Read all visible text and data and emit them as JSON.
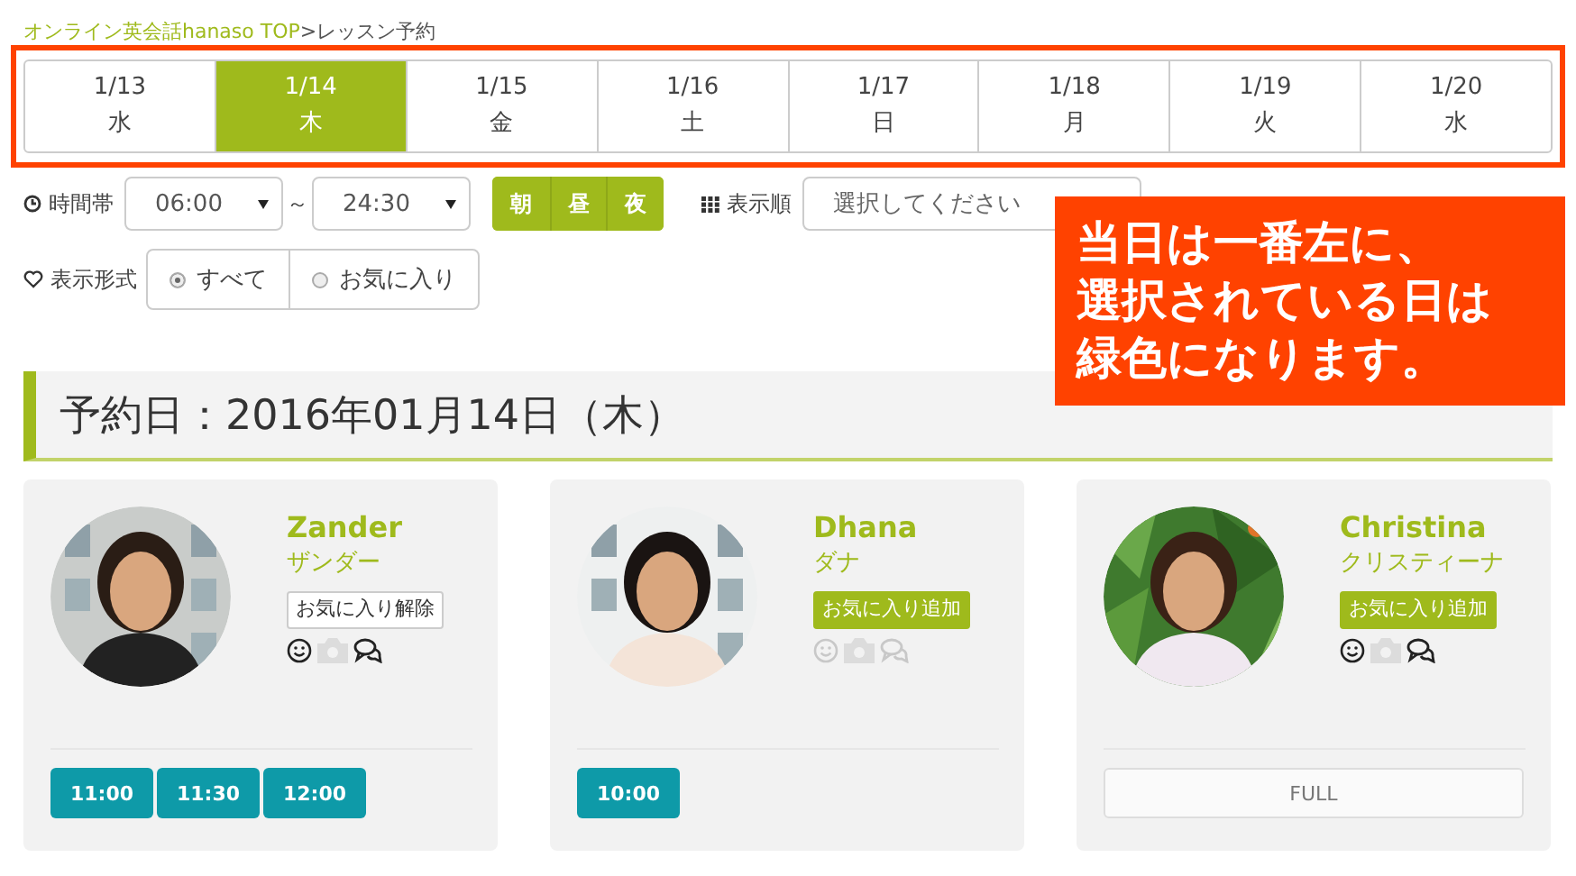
{
  "breadcrumb": {
    "link": "オンライン英会話hanaso TOP",
    "separator": ">",
    "current": "レッスン予約"
  },
  "days": [
    {
      "date": "1/13",
      "weekday": "水",
      "selected": false
    },
    {
      "date": "1/14",
      "weekday": "木",
      "selected": true
    },
    {
      "date": "1/15",
      "weekday": "金",
      "selected": false
    },
    {
      "date": "1/16",
      "weekday": "土",
      "selected": false
    },
    {
      "date": "1/17",
      "weekday": "日",
      "selected": false
    },
    {
      "date": "1/18",
      "weekday": "月",
      "selected": false
    },
    {
      "date": "1/19",
      "weekday": "火",
      "selected": false
    },
    {
      "date": "1/20",
      "weekday": "水",
      "selected": false
    }
  ],
  "time_filter": {
    "label": "時間帯",
    "start": "06:00",
    "separator": "～",
    "end": "24:30",
    "periods": [
      "朝",
      "昼",
      "夜"
    ]
  },
  "sort": {
    "label": "表示順",
    "placeholder": "選択してください"
  },
  "display_filter": {
    "label": "表示形式",
    "options": [
      {
        "label": "すべて",
        "selected": true
      },
      {
        "label": "お気に入り",
        "selected": false
      }
    ]
  },
  "callout": {
    "lines": [
      "当日は一番左に、",
      "選択されている日は",
      "緑色になります。"
    ]
  },
  "heading": "予約日：2016年01月14日（木）",
  "teachers": [
    {
      "name": "Zander",
      "kana": "ザンダー",
      "favorite": true,
      "favorite_label": "お気に入り解除",
      "features": [
        {
          "kind": "smile",
          "available": true
        },
        {
          "kind": "camera",
          "available": false
        },
        {
          "kind": "chat",
          "available": true
        }
      ],
      "slots": [
        {
          "kind": "time",
          "label": "11:00"
        },
        {
          "kind": "time",
          "label": "11:30"
        },
        {
          "kind": "time",
          "label": "12:00"
        }
      ]
    },
    {
      "name": "Dhana",
      "kana": "ダナ",
      "favorite": false,
      "favorite_label": "お気に入り追加",
      "features": [
        {
          "kind": "smile",
          "available": false
        },
        {
          "kind": "camera",
          "available": false
        },
        {
          "kind": "chat",
          "available": false
        }
      ],
      "slots": [
        {
          "kind": "time",
          "label": "10:00"
        }
      ]
    },
    {
      "name": "Christina",
      "kana": "クリスティーナ",
      "favorite": false,
      "favorite_label": "お気に入り追加",
      "features": [
        {
          "kind": "smile",
          "available": true
        },
        {
          "kind": "camera",
          "available": false
        },
        {
          "kind": "chat",
          "available": true
        }
      ],
      "slots": [
        {
          "kind": "full",
          "label": "FULL"
        }
      ]
    }
  ]
}
